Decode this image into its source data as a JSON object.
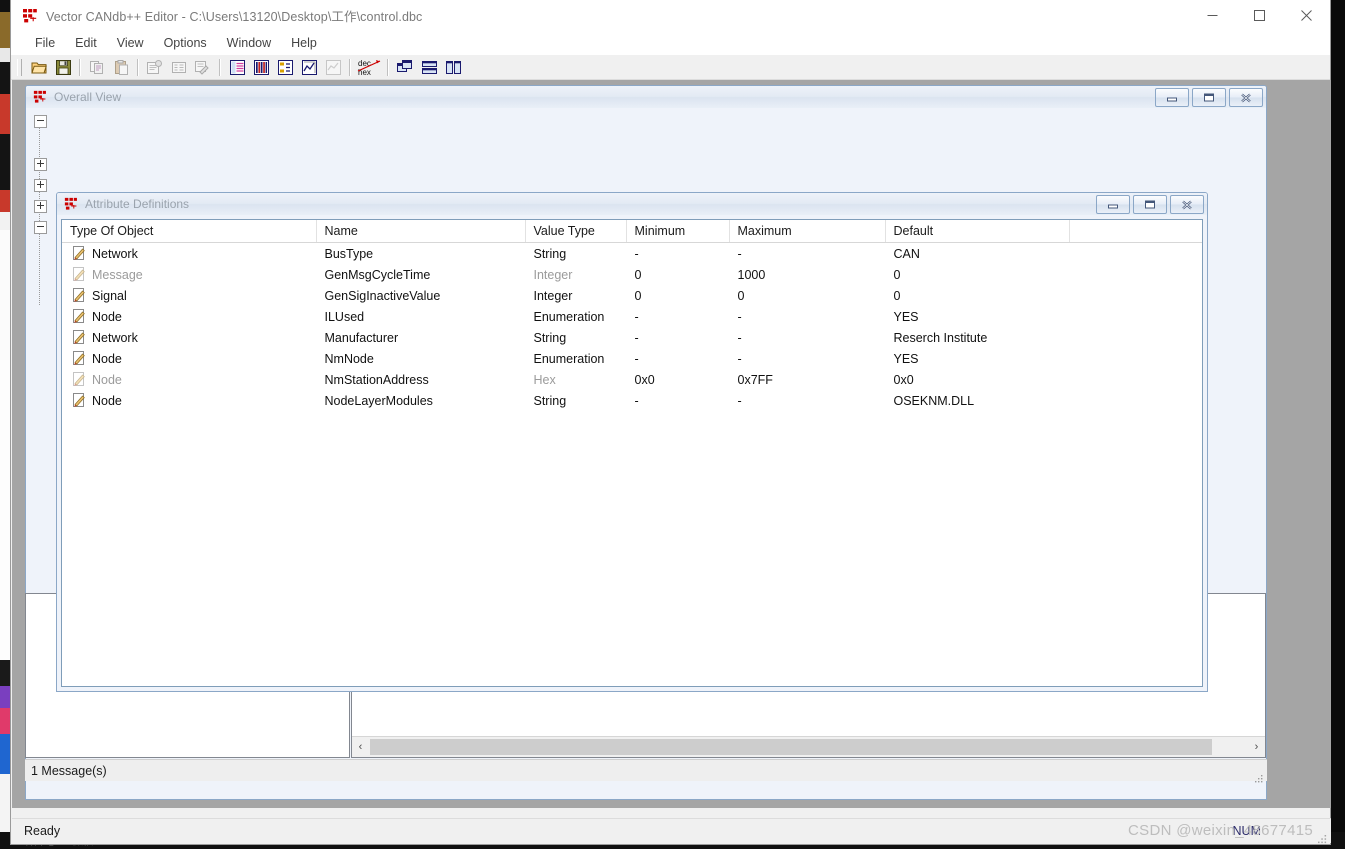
{
  "window": {
    "title": "Vector CANdb++ Editor - C:\\Users\\13120\\Desktop\\工作\\control.dbc",
    "icon": "candb-icon",
    "controls": {
      "minimize": "Minimize",
      "maximize": "Maximize",
      "close": "Close"
    }
  },
  "menubar": {
    "items": [
      {
        "label": "File"
      },
      {
        "label": "Edit"
      },
      {
        "label": "View"
      },
      {
        "label": "Options"
      },
      {
        "label": "Window"
      },
      {
        "label": "Help"
      }
    ]
  },
  "toolbar": {
    "buttons": [
      {
        "name": "open-file-icon",
        "enabled": true
      },
      {
        "name": "save-file-icon",
        "enabled": true
      },
      {
        "name": "copy-icon",
        "enabled": false
      },
      {
        "name": "paste-icon",
        "enabled": false
      },
      {
        "name": "new-object-icon",
        "enabled": false
      },
      {
        "name": "edit-object-icon",
        "enabled": false
      },
      {
        "name": "delete-object-icon",
        "enabled": false
      },
      {
        "name": "messages-view-icon",
        "enabled": true
      },
      {
        "name": "signals-view-icon",
        "enabled": true
      },
      {
        "name": "nodes-view-icon",
        "enabled": true
      },
      {
        "name": "networks-view-icon",
        "enabled": true
      },
      {
        "name": "environment-view-icon",
        "enabled": false
      },
      {
        "name": "dec-hex-toggle-icon",
        "enabled": true
      },
      {
        "name": "cascade-windows-icon",
        "enabled": true
      },
      {
        "name": "tile-horizontal-icon",
        "enabled": true
      },
      {
        "name": "tile-vertical-icon",
        "enabled": true
      }
    ]
  },
  "overall_view": {
    "title": "Overall View",
    "icon": "candb-icon",
    "controls": {
      "minimize": "Minimize",
      "restore": "Restore",
      "close": "Close"
    }
  },
  "attribute_definitions": {
    "title": "Attribute Definitions",
    "icon": "candb-icon",
    "controls": {
      "minimize": "Minimize",
      "restore": "Restore",
      "close": "Close"
    },
    "columns": [
      "Type Of Object",
      "Name",
      "Value Type",
      "Minimum",
      "Maximum",
      "Default",
      ""
    ],
    "rows": [
      {
        "type_of_object": "Network",
        "name": "BusType",
        "value_type": "String",
        "minimum": "-",
        "maximum": "-",
        "default": "CAN",
        "dim": false
      },
      {
        "type_of_object": "Message",
        "name": "GenMsgCycleTime",
        "value_type": "Integer",
        "minimum": "0",
        "maximum": "1000",
        "default": "0",
        "dim": true
      },
      {
        "type_of_object": "Signal",
        "name": "GenSigInactiveValue",
        "value_type": "Integer",
        "minimum": "0",
        "maximum": "0",
        "default": "0",
        "dim": false
      },
      {
        "type_of_object": "Node",
        "name": "ILUsed",
        "value_type": "Enumeration",
        "minimum": "-",
        "maximum": "-",
        "default": "YES",
        "dim": false
      },
      {
        "type_of_object": "Network",
        "name": "Manufacturer",
        "value_type": "String",
        "minimum": "-",
        "maximum": "-",
        "default": "Reserch Institute",
        "dim": false
      },
      {
        "type_of_object": "Node",
        "name": "NmNode",
        "value_type": "Enumeration",
        "minimum": "-",
        "maximum": "-",
        "default": "YES",
        "dim": false
      },
      {
        "type_of_object": "Node",
        "name": "NmStationAddress",
        "value_type": "Hex",
        "minimum": "0x0",
        "maximum": "0x7FF",
        "default": "0x0",
        "dim": true
      },
      {
        "type_of_object": "Node",
        "name": "NodeLayerModules",
        "value_type": "String",
        "minimum": "-",
        "maximum": "-",
        "default": "OSEKNM.DLL",
        "dim": false
      }
    ]
  },
  "message_bar": {
    "text": "1 Message(s)"
  },
  "status_bar": {
    "text": "Ready",
    "num_lock": "NUM",
    "watermark": "CSDN @weixin_48677415"
  },
  "scrollbar": {
    "left_arrow": "‹",
    "right_arrow": "›"
  },
  "colors": {
    "accent": "#8ba7c7",
    "mdi_background": "#a5a5a5",
    "dim_text": "#9b9b9b",
    "title_text": "#7a7a7a"
  }
}
